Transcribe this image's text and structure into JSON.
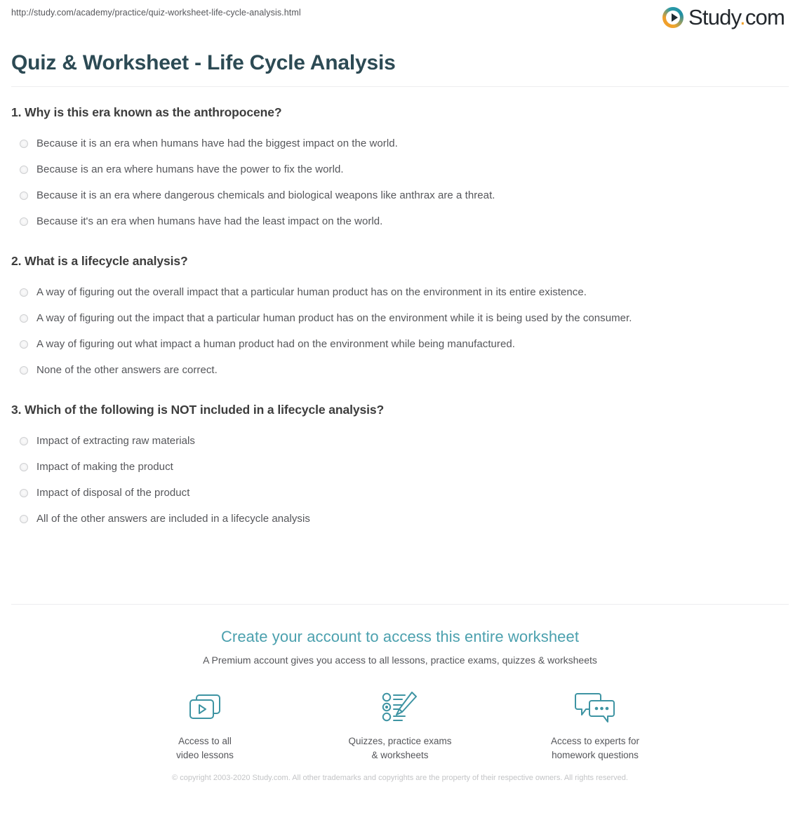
{
  "browser": {
    "url": "http://study.com/academy/practice/quiz-worksheet-life-cycle-analysis.html"
  },
  "brand": {
    "logo_text": "Study",
    "logo_dot": ".",
    "logo_suffix": "com",
    "logo_icon": "play-circle-icon",
    "accent_teal": "#2a9aa8",
    "accent_orange": "#f0a02a"
  },
  "header": {
    "title": "Quiz & Worksheet - Life Cycle Analysis"
  },
  "quiz": {
    "questions": [
      {
        "text": "1. Why is this era known as the anthropocene?",
        "answers": [
          "Because it is an era when humans have had the biggest impact on the world.",
          "Because is an era where humans have the power to fix the world.",
          "Because it is an era where dangerous chemicals and biological weapons like anthrax are a threat.",
          "Because it's an era when humans have had the least impact on the world."
        ]
      },
      {
        "text": "2. What is a lifecycle analysis?",
        "answers": [
          "A way of figuring out the overall impact that a particular human product has on the environment in its entire existence.",
          "A way of figuring out the impact that a particular human product has on the environment while it is being used by the consumer.",
          "A way of figuring out what impact a human product had on the environment while being manufactured.",
          "None of the other answers are correct."
        ]
      },
      {
        "text": "3. Which of the following is NOT included in a lifecycle analysis?",
        "answers": [
          "Impact of extracting raw materials",
          "Impact of making the product",
          "Impact of disposal of the product",
          "All of the other answers are included in a lifecycle analysis"
        ]
      }
    ]
  },
  "cta": {
    "heading": "Create your account to access this entire worksheet",
    "subheading": "A Premium account gives you access to all lessons, practice exams, quizzes & worksheets",
    "perks": [
      {
        "icon": "video-lessons-icon",
        "label": "Access to all\nvideo lessons"
      },
      {
        "icon": "quiz-pencil-icon",
        "label": "Quizzes, practice exams\n& worksheets"
      },
      {
        "icon": "chat-bubbles-icon",
        "label": "Access to experts for\nhomework questions"
      }
    ]
  },
  "footer": {
    "copyright": "© copyright 2003-2020 Study.com. All other trademarks and copyrights are the property of their respective owners. All rights reserved."
  }
}
